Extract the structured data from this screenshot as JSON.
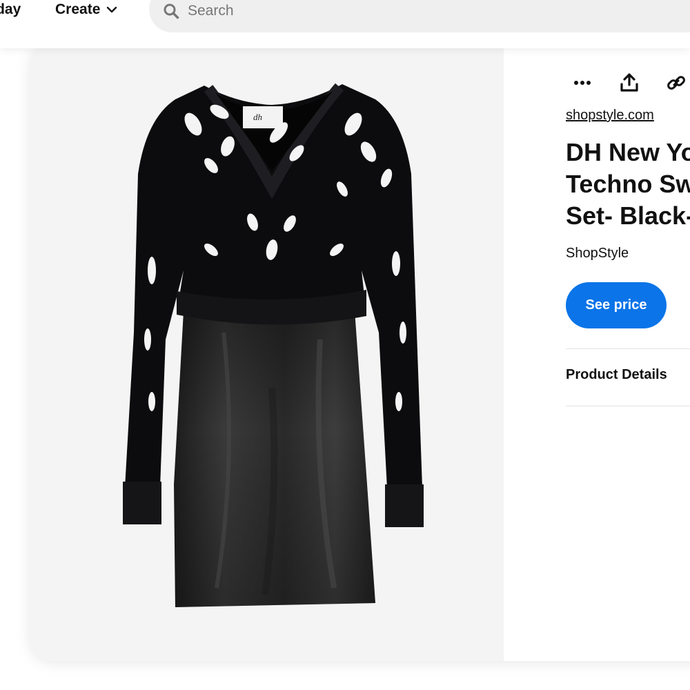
{
  "nav": {
    "today_label": "Today",
    "create_label": "Create",
    "create_icon": "chevron-down-icon"
  },
  "search": {
    "placeholder": "Search",
    "icon": "search-icon"
  },
  "pin": {
    "image_alt": "Black knit sweater with cut-out pattern layered over a black satin slip dress",
    "actions": [
      {
        "name": "more-options",
        "icon": "ellipsis-icon"
      },
      {
        "name": "share",
        "icon": "share-icon"
      },
      {
        "name": "copy-link",
        "icon": "link-icon"
      }
    ],
    "source_domain": "shopstyle.com",
    "title": "DH New York\nTechno Sweater\nSet- Black- S",
    "merchant": "ShopStyle",
    "cta_label": "See price",
    "details_label": "Product Details"
  },
  "colors": {
    "accent": "#0a74e8",
    "image_background": "#f4f4f4",
    "search_background": "#efefef"
  }
}
